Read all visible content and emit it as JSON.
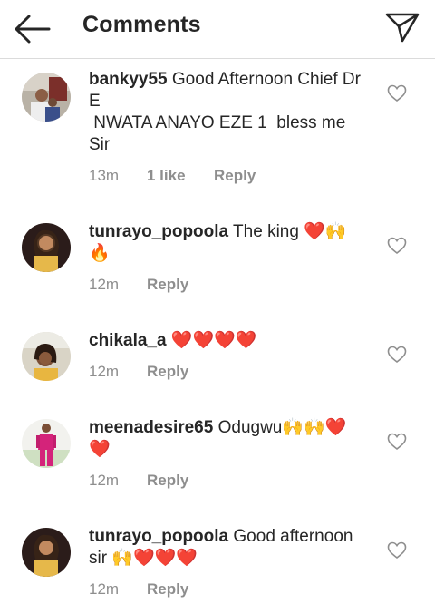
{
  "header": {
    "title": "Comments"
  },
  "colors": {
    "text": "#262626",
    "meta": "#8e8e8e",
    "divider": "#dbdbdb",
    "heart_emoji": "#e0192b"
  },
  "comments": [
    {
      "username": "bankyy55",
      "text": " Good Afternoon Chief Dr E\n NWATA ANAYO EZE 1  bless me Sir",
      "time": "13m",
      "likes": "1 like",
      "reply": "Reply"
    },
    {
      "username": "tunrayo_popoola",
      "text": " The king ❤️🙌\n🔥",
      "time": "12m",
      "likes": "",
      "reply": "Reply"
    },
    {
      "username": "chikala_a",
      "text": " ❤️❤️❤️❤️",
      "time": "12m",
      "likes": "",
      "reply": "Reply"
    },
    {
      "username": "meenadesire65",
      "text": " Odugwu🙌🙌❤️\n❤️",
      "time": "12m",
      "likes": "",
      "reply": "Reply"
    },
    {
      "username": "tunrayo_popoola",
      "text": " Good afternoon sir 🙌❤️❤️❤️",
      "time": "12m",
      "likes": "",
      "reply": "Reply"
    }
  ],
  "icons": {
    "back": "arrow-left-icon",
    "send": "send-icon",
    "like": "heart-outline-icon"
  }
}
